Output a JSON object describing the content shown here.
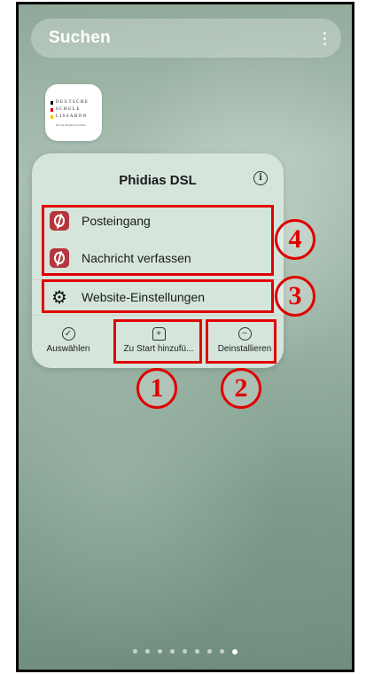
{
  "search": {
    "label": "Suchen"
  },
  "app": {
    "name": "Phidias DSL",
    "logo_lines": [
      "DEUTSCHE",
      "SCHULE",
      "LISSABON"
    ],
    "logo_sub": "Escola Alemã de Lisboa"
  },
  "shortcuts": [
    {
      "label": "Posteingang",
      "icon": "phidias-icon"
    },
    {
      "label": "Nachricht verfassen",
      "icon": "phidias-icon"
    },
    {
      "label": "Website-Einstellungen",
      "icon": "gear-icon"
    }
  ],
  "actions": [
    {
      "label": "Auswählen",
      "icon": "check-circle-icon"
    },
    {
      "label": "Zu Start hinzufü...",
      "icon": "add-home-icon"
    },
    {
      "label": "Deinstallieren",
      "icon": "minus-circle-icon"
    }
  ],
  "annotations": [
    "1",
    "2",
    "3",
    "4"
  ],
  "page_indicator": {
    "count": 9,
    "active": 9
  },
  "colors": {
    "annotation": "#e00000",
    "popup_bg": "#d5e5dc",
    "phidias_red": "#b5373d"
  }
}
